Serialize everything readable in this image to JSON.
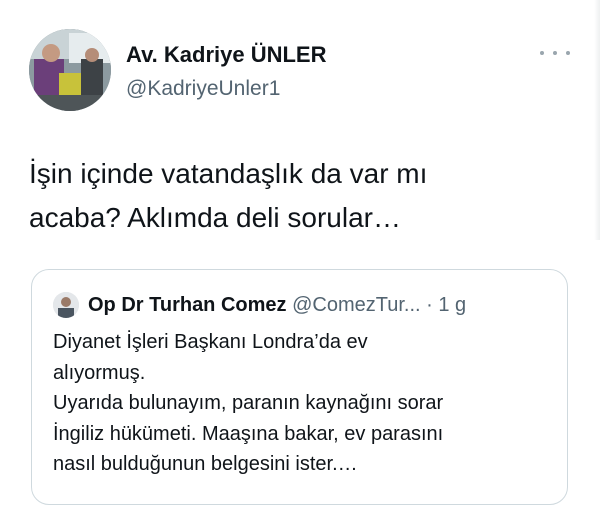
{
  "tweet": {
    "author_name": "Av. Kadriye ÜNLER",
    "author_handle": "@KadriyeUnler1",
    "more_icon": "more-horizontal-icon",
    "text_lines": [
      "İşin içinde vatandaşlık da var mı",
      "acaba? Aklımda deli sorular…"
    ]
  },
  "quoted_tweet": {
    "author_name": "Op Dr Turhan Comez",
    "author_handle": "@ComezTur...",
    "separator": "·",
    "time": "1 g",
    "text_lines": [
      "Diyanet İşleri Başkanı Londra’da ev",
      "alıyormuş.",
      "Uyarıda bulunayım, paranın kaynağını sorar",
      "İngiliz hükümeti. Maaşına bakar, ev parasını",
      "nasıl bulduğunun belgesini ister.…"
    ]
  },
  "colors": {
    "text_primary": "#0f1419",
    "text_secondary": "#536471",
    "border": "#cfd9de"
  }
}
